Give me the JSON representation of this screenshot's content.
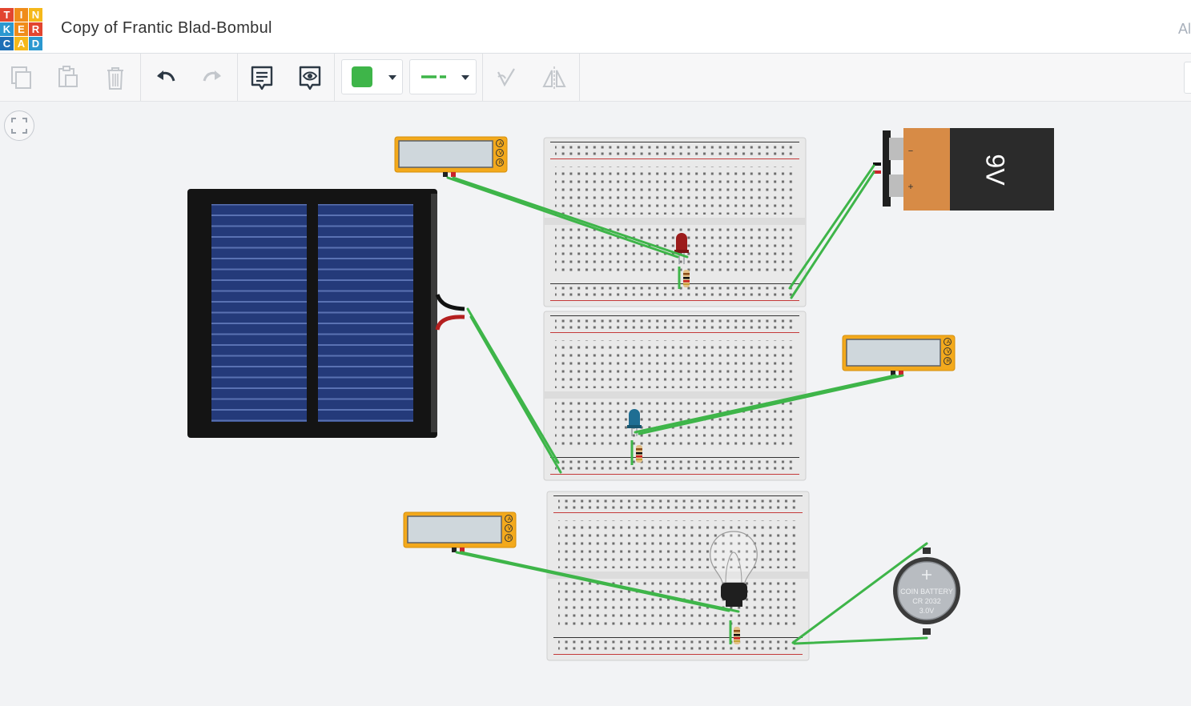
{
  "app": {
    "logo_letters": [
      "T",
      "I",
      "N",
      "K",
      "E",
      "R",
      "C",
      "A",
      "D"
    ],
    "logo_colors": [
      "#e2452f",
      "#f08c1a",
      "#f5b81a",
      "#2b98d0",
      "#f08c1a",
      "#e2452f",
      "#1e6fb6",
      "#f5b81a",
      "#2b98d0"
    ],
    "title": "Copy of Frantic Blad-Bombul",
    "header_right": "Al"
  },
  "toolbar": {
    "items": [
      "copy-icon",
      "paste-icon",
      "delete-icon",
      "undo-icon",
      "redo-icon",
      "notes-icon",
      "notes-visibility-icon",
      "color-picker",
      "wire-type-picker",
      "rotate-icon",
      "flip-icon"
    ],
    "wire_color": "#3eb549"
  },
  "components": {
    "battery_9v_label": "9V",
    "battery_minus": "−",
    "battery_plus": "+",
    "coin_battery_line1": "COIN BATTERY",
    "coin_battery_line2": "CR 2032",
    "coin_battery_line3": "3.0V",
    "multimeter_modes": [
      "A",
      "V",
      "R"
    ]
  },
  "colors": {
    "wire": "#3eb549",
    "multimeter": "#f3a91c",
    "breadboard": "#e9e9e9",
    "rail_red": "#c43a3a",
    "led_red": "#9c1c1c",
    "led_blue": "#1f6e93"
  }
}
